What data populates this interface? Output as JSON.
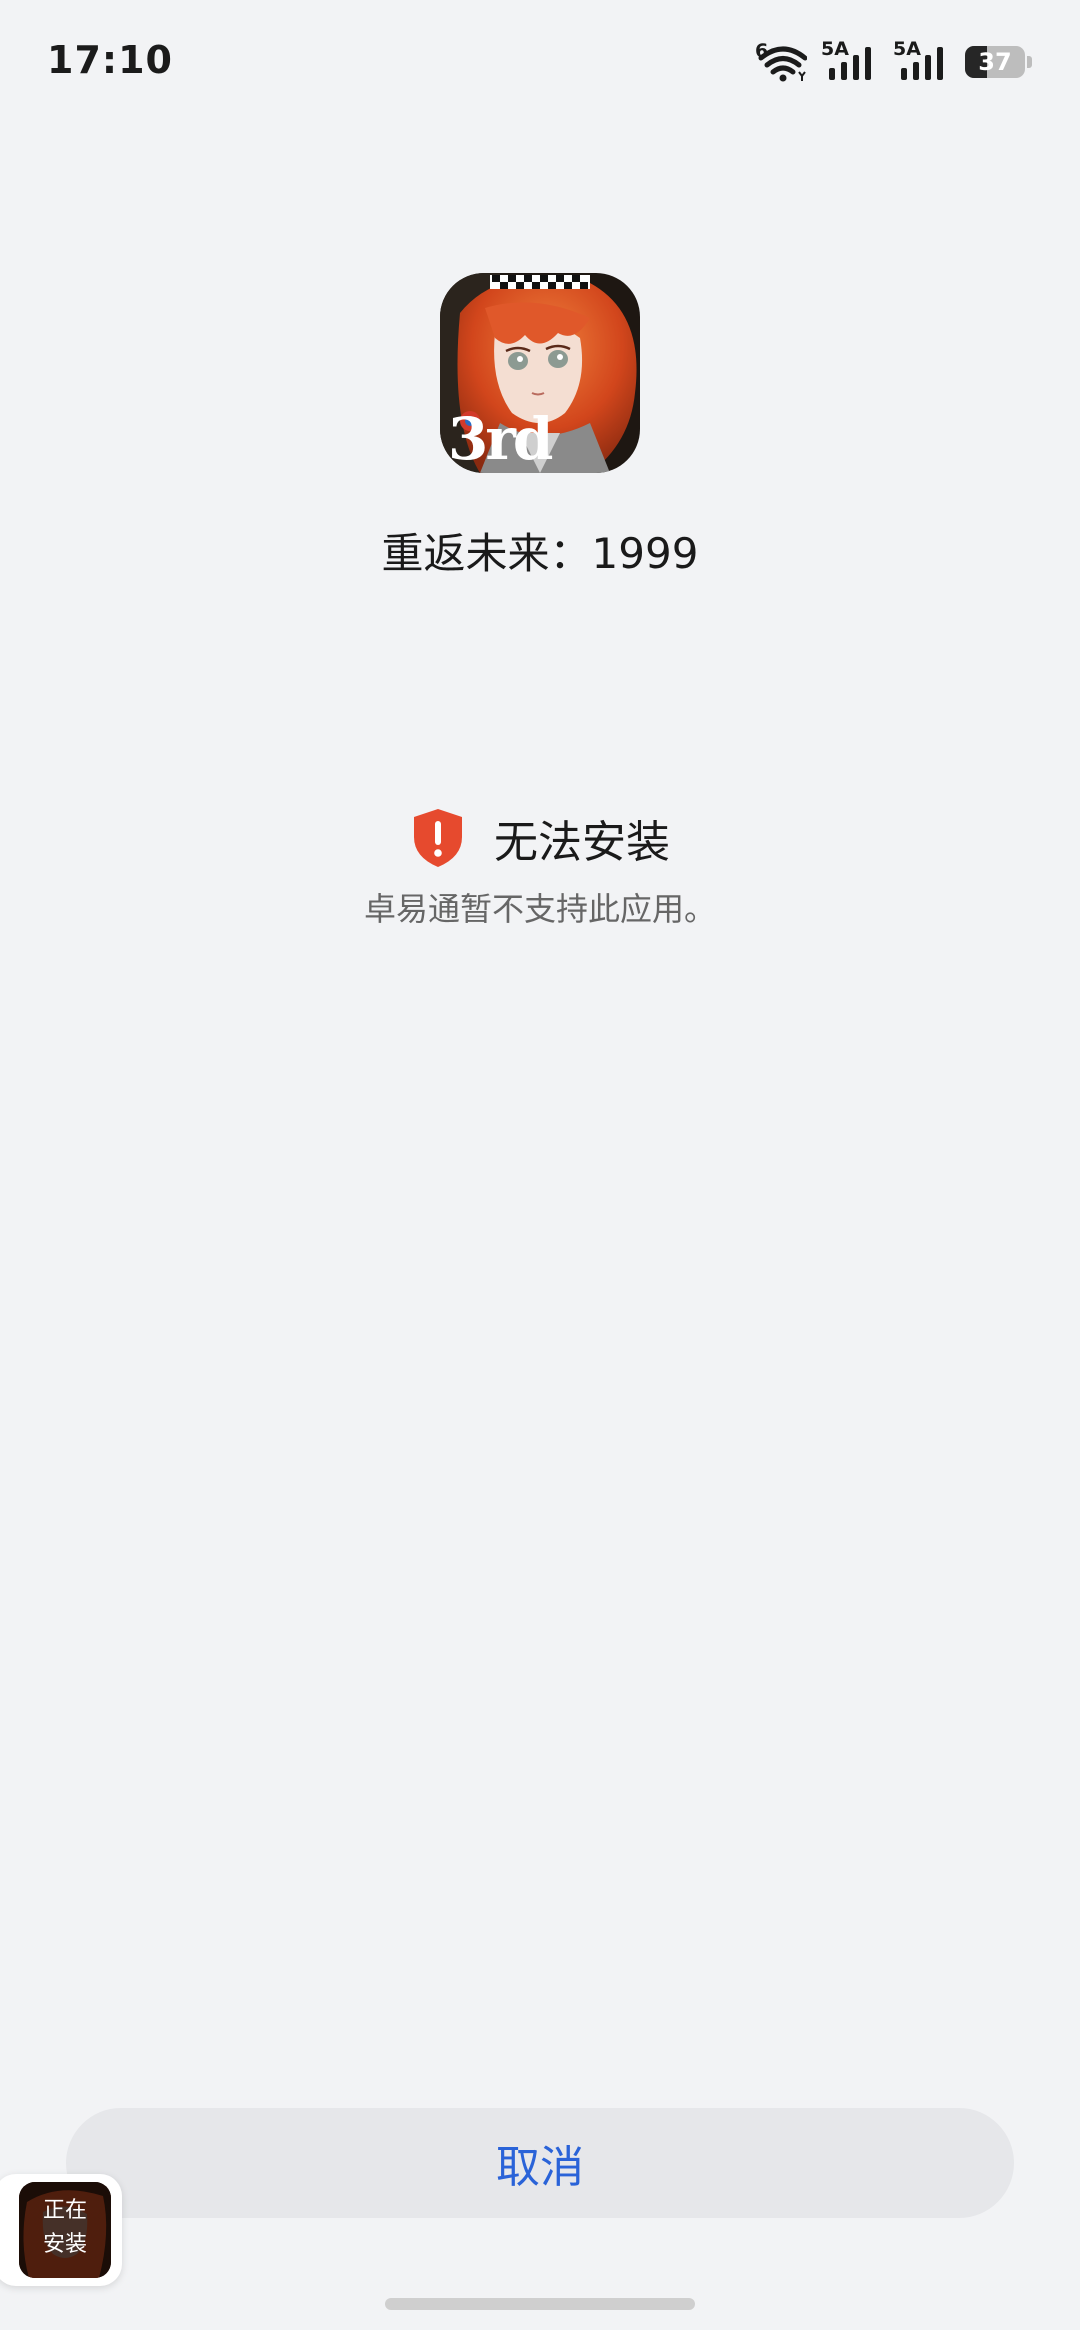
{
  "status_bar": {
    "time": "17:10",
    "wifi_label": "6",
    "sim1_label": "5A",
    "sim2_label": "5A",
    "battery_level": "37",
    "battery_percent": 37
  },
  "app": {
    "name": "重返未来：1999",
    "icon": "app-icon-reverse-1999",
    "icon_text": "3rd"
  },
  "error": {
    "icon": "shield-alert-icon",
    "title": "无法安装",
    "description": "卓易通暂不支持此应用。",
    "color": "#e64a2e"
  },
  "cancel_button": {
    "label": "取消",
    "color": "#2a63d8"
  },
  "install_bubble": {
    "label": "正在\n安装"
  }
}
